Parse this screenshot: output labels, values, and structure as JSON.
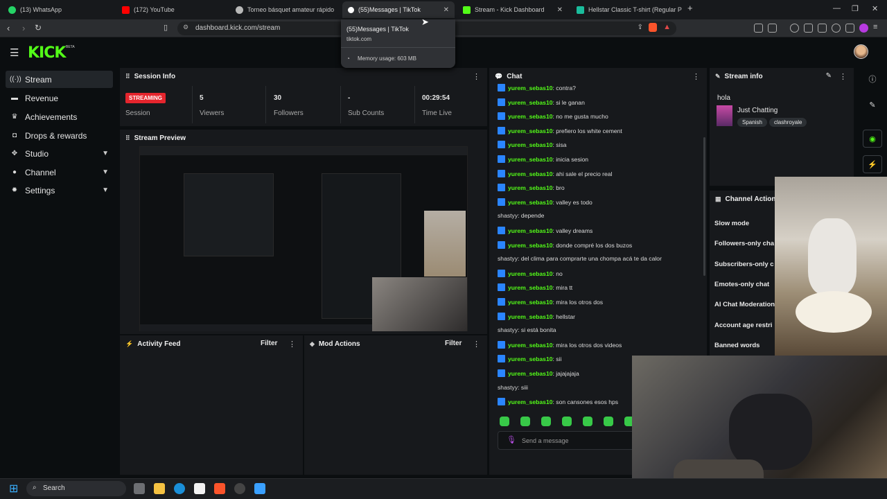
{
  "browser": {
    "tabs": [
      {
        "label": "(13) WhatsApp",
        "icon": "whatsapp-icon",
        "color": "#25d366"
      },
      {
        "label": "(172) YouTube",
        "icon": "youtube-icon",
        "color": "#ff0000"
      },
      {
        "label": "Torneo básquet amateur rápido",
        "icon": "chat-icon",
        "color": "#b8b8b8"
      },
      {
        "label": "(55)Messages | TikTok",
        "icon": "tiktok-icon",
        "color": "#ffffff"
      },
      {
        "label": "Stream - Kick Dashboard",
        "icon": "kick-icon",
        "color": "#53fc18"
      },
      {
        "label": "Hellstar Classic T-shirt (Regular Print)",
        "icon": "store-icon",
        "color": "#1abc9c"
      }
    ],
    "new_tab": "+",
    "url": "dashboard.kick.com/stream",
    "tooltip": {
      "title": "(55)Messages | TikTok",
      "domain": "tiktok.com",
      "memory": "Memory usage: 603 MB"
    }
  },
  "app": {
    "logo": "KICK",
    "beta": "BETA",
    "accent": "#53fc18"
  },
  "sidebar": {
    "items": [
      {
        "label": "Stream",
        "icon": "stream-icon"
      },
      {
        "label": "Revenue",
        "icon": "money-icon"
      },
      {
        "label": "Achievements",
        "icon": "trophy-icon"
      },
      {
        "label": "Drops & rewards",
        "icon": "gift-icon"
      },
      {
        "label": "Studio",
        "icon": "grid-icon"
      },
      {
        "label": "Channel",
        "icon": "person-icon"
      },
      {
        "label": "Settings",
        "icon": "gear-icon"
      }
    ]
  },
  "session": {
    "title": "Session Info",
    "status": "STREAMING",
    "status_label": "Session",
    "viewers": "5",
    "viewers_label": "Viewers",
    "followers": "30",
    "followers_label": "Followers",
    "subs": "-",
    "subs_label": "Sub Counts",
    "time": "00:29:54",
    "time_label": "Time Live"
  },
  "preview": {
    "title": "Stream Preview"
  },
  "activity": {
    "title": "Activity Feed",
    "filter": "Filter"
  },
  "mod": {
    "title": "Mod Actions",
    "filter": "Filter"
  },
  "chat": {
    "title": "Chat",
    "placeholder": "Send a message",
    "messages": [
      {
        "user": "yurem_sebas10",
        "text": ": contra?",
        "badge": true
      },
      {
        "user": "yurem_sebas10",
        "text": ": si le ganan",
        "badge": true
      },
      {
        "user": "yurem_sebas10",
        "text": ": no me gusta mucho",
        "badge": true
      },
      {
        "user": "yurem_sebas10",
        "text": ": prefiero los white cement",
        "badge": true
      },
      {
        "user": "yurem_sebas10",
        "text": ": sisa",
        "badge": true
      },
      {
        "user": "yurem_sebas10",
        "text": ": inicia sesion",
        "badge": true
      },
      {
        "user": "yurem_sebas10",
        "text": ": ahi sale el precio real",
        "badge": true
      },
      {
        "user": "yurem_sebas10",
        "text": ": bro",
        "badge": true
      },
      {
        "user": "yurem_sebas10",
        "text": ": valley es todo",
        "badge": true
      },
      {
        "user": "shastyy",
        "text": ": depende",
        "badge": false
      },
      {
        "user": "yurem_sebas10",
        "text": ": valley dreams",
        "badge": true
      },
      {
        "user": "yurem_sebas10",
        "text": ": donde compré los dos buzos",
        "badge": true
      },
      {
        "user": "shastyy",
        "text": ": del clima para comprarte una chompa acá te da calor",
        "badge": false
      },
      {
        "user": "yurem_sebas10",
        "text": ": no",
        "badge": true
      },
      {
        "user": "yurem_sebas10",
        "text": ": mira tt",
        "badge": true
      },
      {
        "user": "yurem_sebas10",
        "text": ": mira los otros dos",
        "badge": true
      },
      {
        "user": "yurem_sebas10",
        "text": ": hellstar",
        "badge": true
      },
      {
        "user": "shastyy",
        "text": ": si está bonita",
        "badge": false
      },
      {
        "user": "yurem_sebas10",
        "text": ": mira los otros dos videos",
        "badge": true
      },
      {
        "user": "yurem_sebas10",
        "text": ": sii",
        "badge": true
      },
      {
        "user": "yurem_sebas10",
        "text": ": jajajajaja",
        "badge": true
      },
      {
        "user": "shastyy",
        "text": ": siii",
        "badge": false
      },
      {
        "user": "yurem_sebas10",
        "text": ": son cansones esos hps",
        "badge": true
      }
    ]
  },
  "stream_info": {
    "title": "Stream info",
    "stream_title": "hola",
    "category": "Just Chatting",
    "tags": [
      "Spanish",
      "clashroyale"
    ]
  },
  "channel_actions": {
    "title": "Channel Actions",
    "items": [
      "Slow mode",
      "Followers-only cha",
      "Subscribers-only c",
      "Emotes-only chat",
      "AI Chat Moderation",
      "Account age restri",
      "Banned words"
    ]
  },
  "taskbar": {
    "search": "Search"
  }
}
